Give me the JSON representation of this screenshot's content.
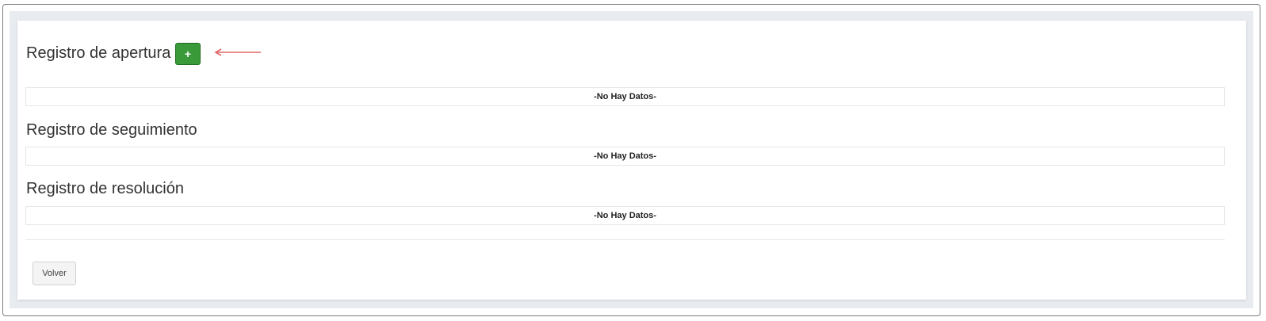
{
  "sections": [
    {
      "title": "Registro de apertura",
      "empty_text": "-No Hay Datos-"
    },
    {
      "title": "Registro de seguimiento",
      "empty_text": "-No Hay Datos-"
    },
    {
      "title": "Registro de resolución",
      "empty_text": "-No Hay Datos-"
    }
  ],
  "add_button": {
    "label": "+",
    "icon": "plus-icon",
    "color": "#3a9a3a"
  },
  "annotation": {
    "icon": "arrow-left-icon",
    "color": "#e06666"
  },
  "back_button": {
    "label": "Volver"
  }
}
